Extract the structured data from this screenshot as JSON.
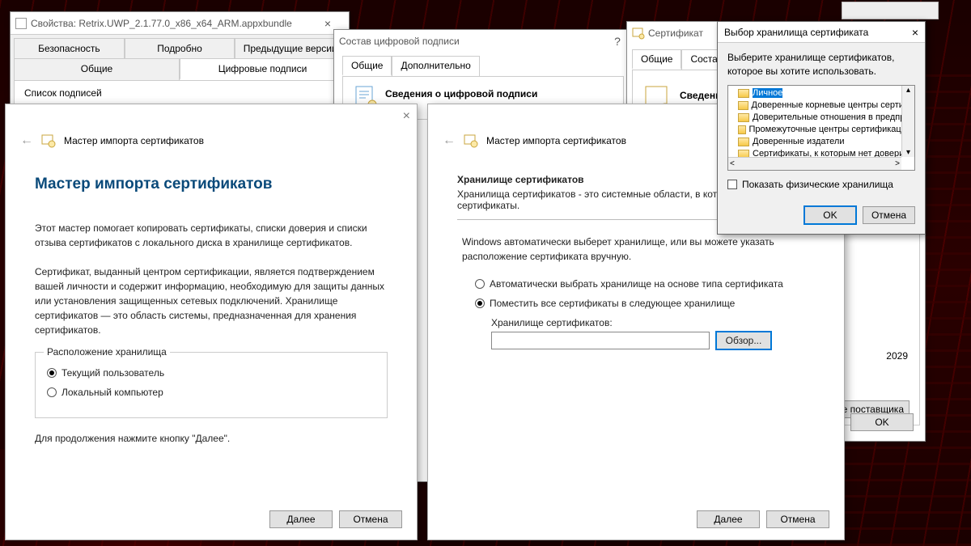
{
  "props_window": {
    "title": "Свойства: Retrix.UWP_2.1.77.0_x86_x64_ARM.appxbundle",
    "tabs_row1": [
      "Безопасность",
      "Подробно",
      "Предыдущие версии"
    ],
    "tabs_row2": [
      "Общие",
      "Цифровые подписи"
    ],
    "list_label": "Список подписей"
  },
  "sig_window": {
    "title": "Состав цифровой подписи",
    "tabs": [
      "Общие",
      "Дополнительно"
    ],
    "heading": "Сведения о цифровой подписи"
  },
  "cert_window": {
    "title": "Сертификат",
    "tabs": [
      "Общие",
      "Состав"
    ],
    "heading": "Сведени",
    "year": "2029",
    "vendor_btn_frag": "ение поставщика",
    "ok": "OK"
  },
  "wizard1": {
    "breadcrumb": "Мастер импорта сертификатов",
    "h1": "Мастер импорта сертификатов",
    "p1": "Этот мастер помогает копировать сертификаты, списки доверия и списки отзыва сертификатов с локального диска в хранилище сертификатов.",
    "p2": "Сертификат, выданный центром сертификации, является подтверждением вашей личности и содержит информацию, необходимую для защиты данных или установления защищенных сетевых подключений. Хранилище сертификатов — это область системы, предназначенная для хранения сертификатов.",
    "group_legend": "Расположение хранилища",
    "radio_current": "Текущий пользователь",
    "radio_local": "Локальный компьютер",
    "hint": "Для продолжения нажмите кнопку \"Далее\".",
    "next": "Далее",
    "cancel": "Отмена"
  },
  "wizard2": {
    "breadcrumb": "Мастер импорта сертификатов",
    "h2": "Хранилище сертификатов",
    "sub": "Хранилища сертификатов - это системные области, в которых хранятся сертификаты.",
    "p1": "Windows автоматически выберет хранилище, или вы можете указать расположение сертификата вручную.",
    "radio_auto": "Автоматически выбрать хранилище на основе типа сертификата",
    "radio_place": "Поместить все сертификаты в следующее хранилище",
    "field_label": "Хранилище сертификатов:",
    "browse": "Обзор...",
    "next": "Далее",
    "cancel": "Отмена"
  },
  "selector": {
    "title": "Выбор хранилища сертификата",
    "prompt": "Выберите хранилище сертификатов, которое вы хотите использовать.",
    "items": [
      "Личное",
      "Доверенные корневые центры сертиф",
      "Доверительные отношения в предпри",
      "Промежуточные центры сертификации",
      "Доверенные издатели",
      "Сертификаты, к которым нет доверия"
    ],
    "show_physical": "Показать физические хранилища",
    "ok": "OK",
    "cancel": "Отмена"
  }
}
